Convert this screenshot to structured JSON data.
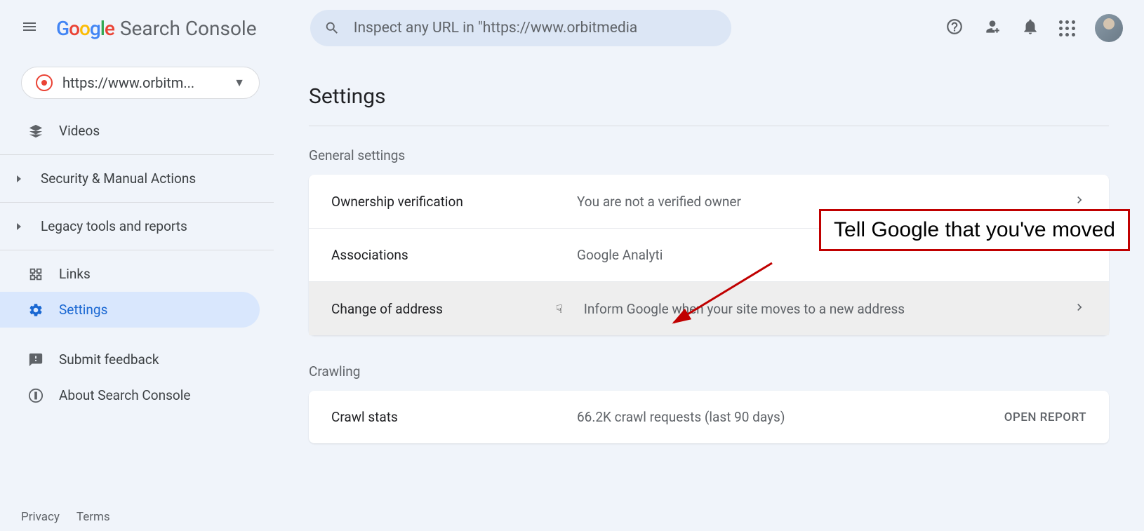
{
  "header": {
    "product_name": "Search Console",
    "search_placeholder": "Inspect any URL in \"https://www.orbitmedia"
  },
  "sidebar": {
    "property_url": "https://www.orbitm...",
    "items": {
      "videos": "Videos",
      "security": "Security & Manual Actions",
      "legacy": "Legacy tools and reports",
      "links": "Links",
      "settings": "Settings",
      "feedback": "Submit feedback",
      "about": "About Search Console"
    },
    "footer": {
      "privacy": "Privacy",
      "terms": "Terms"
    }
  },
  "main": {
    "title": "Settings",
    "sections": {
      "general": {
        "label": "General settings",
        "rows": {
          "ownership": {
            "label": "Ownership verification",
            "value": "You are not a verified owner"
          },
          "associations": {
            "label": "Associations",
            "value": "Google Analyti"
          },
          "change_address": {
            "label": "Change of address",
            "value": "Inform Google when your site moves to a new address"
          }
        }
      },
      "crawling": {
        "label": "Crawling",
        "rows": {
          "crawl_stats": {
            "label": "Crawl stats",
            "value": "66.2K crawl requests (last 90 days)",
            "action": "OPEN REPORT"
          }
        }
      }
    }
  },
  "annotation": {
    "text": "Tell Google that you've moved"
  }
}
